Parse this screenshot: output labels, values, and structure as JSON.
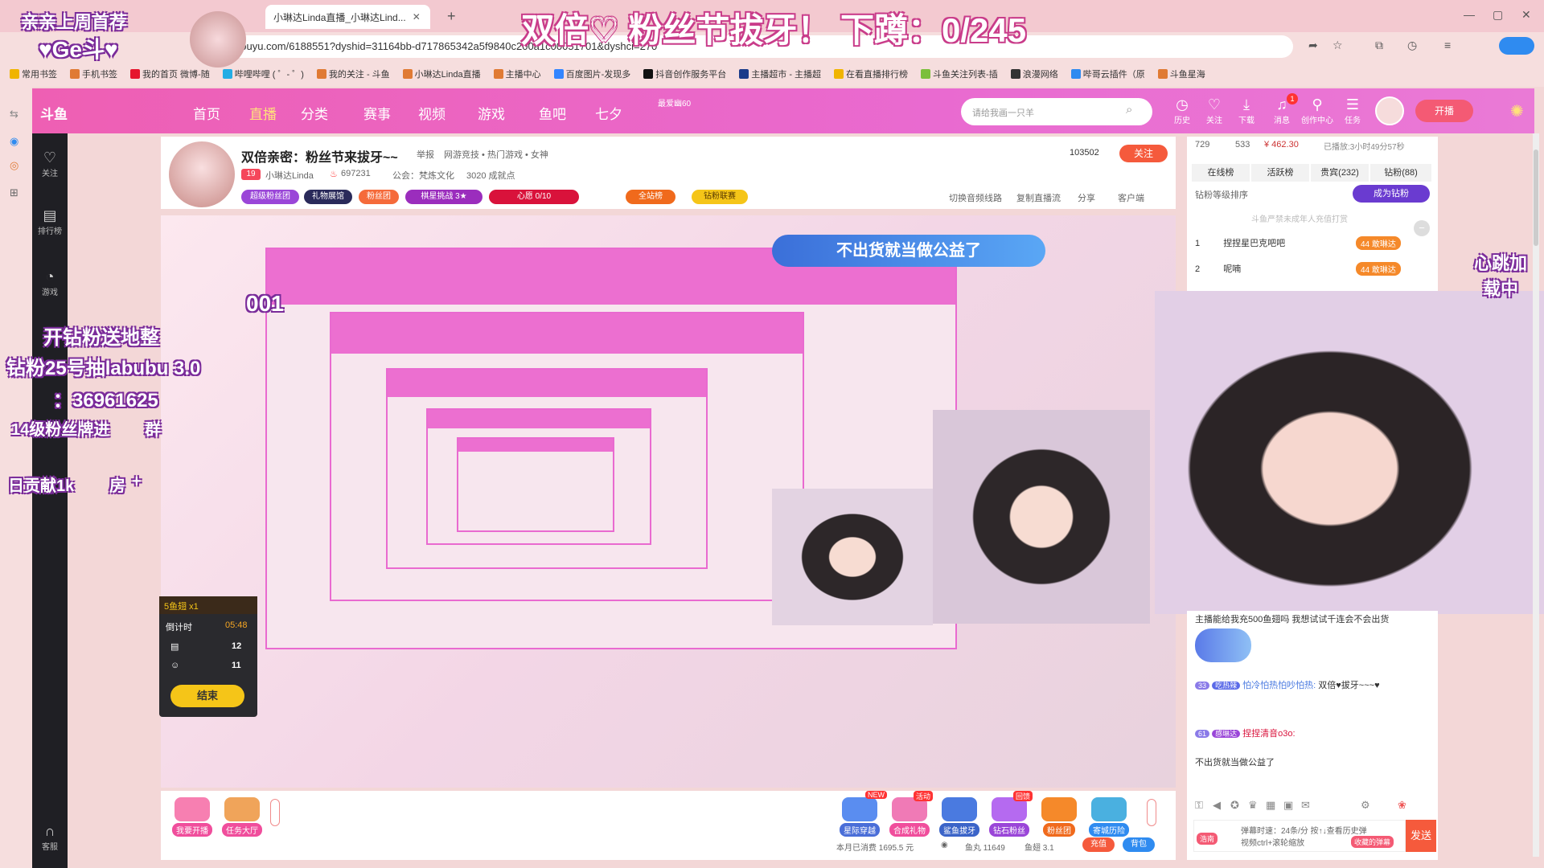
{
  "browser": {
    "tab_title": "小琳达Linda直播_小琳达Lind...",
    "url": "douyu.com/6188551?dyshid=31164bb-d717865342a5f9840c200a1c00051701&dyshci=270",
    "bookmarks": [
      "常用书签",
      "手机书签",
      "我的首页 微博-随",
      "哔哩哔哩 ( ゜- ゜)",
      "我的关注 - 斗鱼",
      "小琳达Linda直播",
      "主播中心",
      "百度图片-发现多",
      "抖音创作服务平台",
      "主播超市 - 主播超",
      "在看直播排行榜",
      "斗鱼关注列表-插",
      "浪漫网络",
      "哔哥云插件（原",
      "斗鱼星海"
    ]
  },
  "overlay": {
    "top_title": "双倍♡ 粉丝节拔牙！  下蹲：0/245",
    "corner_title": "亲亲上周首荐",
    "corner_name": "♥Ge斗♥",
    "left_lines": [
      "开钻粉送地整",
      "钻粉25号抽labubu 3.0",
      "：36961625",
      "14级粉丝牌进",
      "群",
      "日贡献1k",
      "房",
      "+"
    ],
    "counter": "001",
    "banner_text": "不出货就当做公益了",
    "side_badge": "心跳加载中"
  },
  "nav": {
    "items": [
      "首页",
      "直播",
      "分类",
      "赛事",
      "视频",
      "游戏",
      "鱼吧",
      "七夕"
    ],
    "promo": "最爱幽60",
    "search_placeholder": "请给我画一只羊",
    "icons": [
      {
        "icon": "history-icon",
        "label": "历史"
      },
      {
        "icon": "heart-icon",
        "label": "关注"
      },
      {
        "icon": "download-icon",
        "label": "下载"
      },
      {
        "icon": "bell-icon",
        "label": "消息",
        "badge": "1"
      },
      {
        "icon": "creator-icon",
        "label": "创作中心"
      },
      {
        "icon": "task-icon",
        "label": "任务"
      }
    ],
    "kaibo": "开播"
  },
  "sidebar": {
    "items": [
      {
        "icon": "heart-icon",
        "label": "关注"
      },
      {
        "icon": "rank-icon",
        "label": "排行榜"
      },
      {
        "icon": "game-icon",
        "label": "游戏"
      },
      {
        "icon": "headset-icon",
        "label": "客服"
      }
    ]
  },
  "room": {
    "title": "双倍亲密：粉丝节来拔牙~~",
    "report": "举报",
    "category": "网游竞技 • 热门游戏 • 女神",
    "level": "19",
    "anchor": "小琳达Linda",
    "hot": "697231",
    "guild": "公会：梵炼文化",
    "growth": "3020 成就点",
    "follow_count": "103502",
    "follow_label": "关注",
    "pills": [
      "超级粉丝团",
      "礼物展馆",
      "粉丝团",
      "棋星挑战 3★",
      "心愿 0/10",
      "全站榜",
      "钻粉联赛"
    ],
    "actions": [
      "切换音频线路",
      "复制直播流",
      "分享",
      "客户端"
    ]
  },
  "rightpanel": {
    "stats": {
      "viewers": "729",
      "fans": "533",
      "gifts": "¥ 462.30",
      "duration": "已播放:3小时49分57秒"
    },
    "tabs": [
      "在线榜",
      "活跃榜",
      "贵宾(232)",
      "钻粉(88)"
    ],
    "rank_title": "钻粉等级排序",
    "become": "成为钻粉",
    "notice": "斗鱼严禁未成年人充值打赏",
    "rank_users": [
      {
        "rank": "1",
        "name": "捏捏星巴克吧吧",
        "badge": "44 敢琳达"
      },
      {
        "rank": "2",
        "name": "呢喃",
        "badge": "44 敢琳达"
      }
    ],
    "chat": [
      {
        "text": "主播能给我充500鱼翅吗 我想试试千连会不会出货"
      },
      {
        "level": "33",
        "medal": "吃热辣",
        "user": "怕冷怕热怕吵怕热:",
        "text": "双倍♥拔牙~~~♥"
      },
      {
        "level": "61",
        "medal": "感琳达",
        "user": "捏捏清音o3o:",
        "text": "不出货就当做公益了"
      }
    ],
    "input_hint_1": "弹幕时速：24条/分 按↑↓查看历史弹",
    "input_hint_2": "视频ctrl+滚轮缩放",
    "input_tag": "浩南",
    "fav_tag": "收藏的弹幕",
    "send": "发送"
  },
  "countdown": {
    "title": "5鱼翅 x1",
    "timer_label": "倒计时",
    "timer": "05:48",
    "count1": "12",
    "count2": "11",
    "end": "结束"
  },
  "bottombar": {
    "left_buttons": [
      "我要开播",
      "任务大厅"
    ],
    "right_buttons": [
      {
        "label": "星际穿越",
        "tag": "NEW"
      },
      {
        "label": "合成礼物",
        "tag": "活动"
      },
      {
        "label": "鲨鱼拔牙",
        "tag": ""
      },
      {
        "label": "钻石粉丝",
        "tag": "回馈"
      },
      {
        "label": "粉丝团",
        "tag": ""
      },
      {
        "label": "寄城历险",
        "tag": ""
      }
    ],
    "spend": "本月已消费 1695.5 元",
    "fish_balls": "鱼丸 11649",
    "fish_fin": "鱼翅 3.1",
    "recharge": "充值",
    "backpack": "背包"
  },
  "colors": {
    "brand_pink": "#ee5fb3",
    "follow_red": "#f55a3c",
    "overlay_purple": "#7a2b9a"
  }
}
